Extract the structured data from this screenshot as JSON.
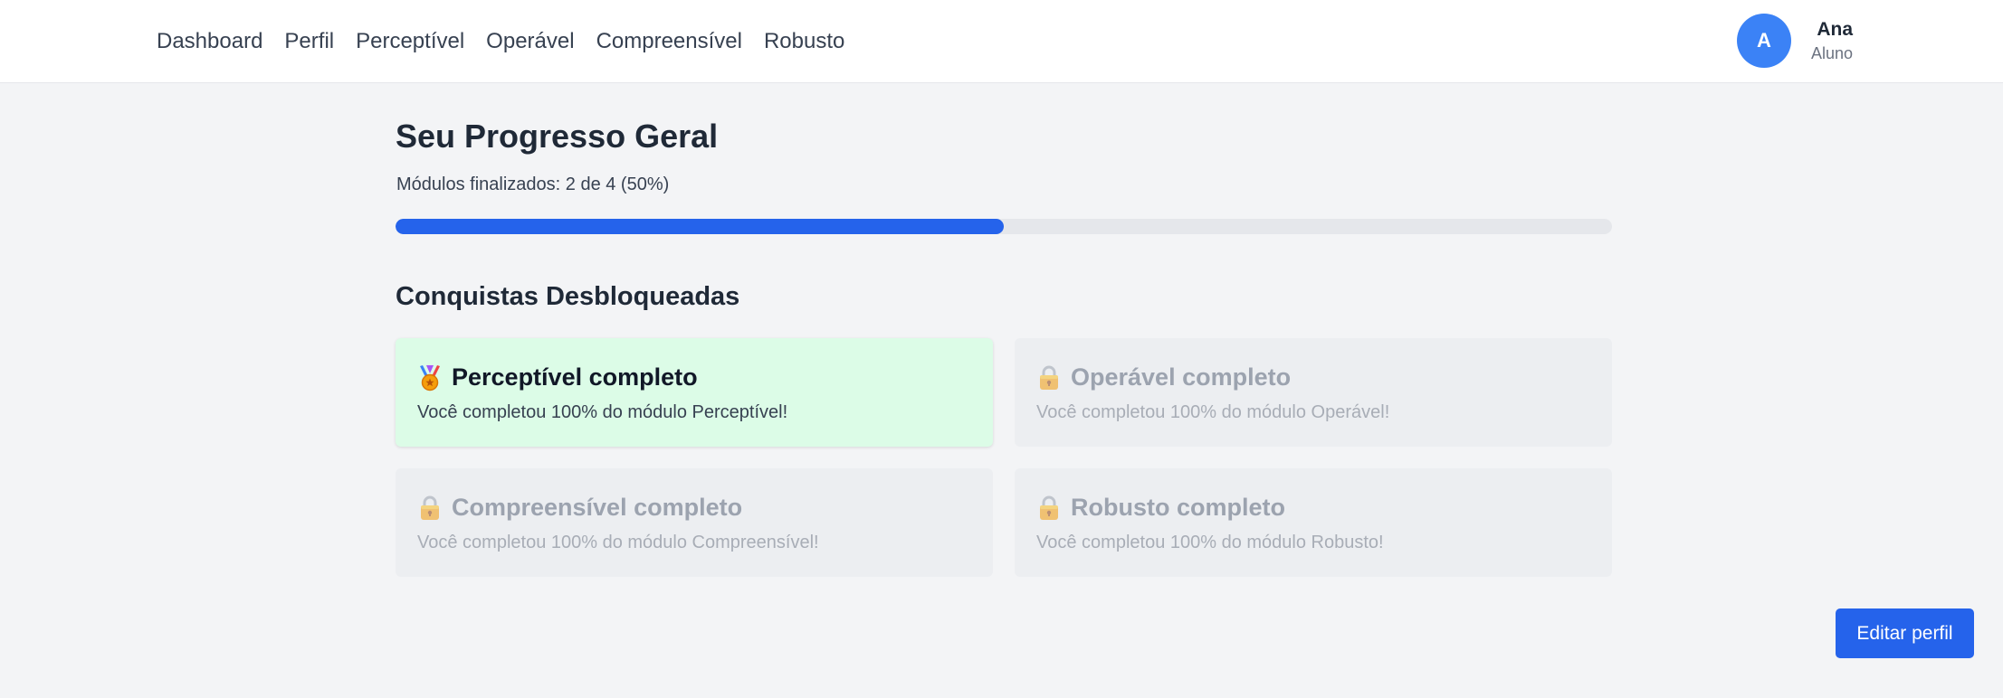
{
  "nav": {
    "items": [
      {
        "label": "Dashboard"
      },
      {
        "label": "Perfil"
      },
      {
        "label": "Perceptível"
      },
      {
        "label": "Operável"
      },
      {
        "label": "Compreensível"
      },
      {
        "label": "Robusto"
      }
    ]
  },
  "user": {
    "initial": "A",
    "name": "Ana",
    "role": "Aluno"
  },
  "progress": {
    "title": "Seu Progresso Geral",
    "summary": "Módulos finalizados: 2 de 4 (50%)",
    "completed": 2,
    "total": 4,
    "percent": 50
  },
  "achievements": {
    "title": "Conquistas Desbloqueadas",
    "items": [
      {
        "icon": "medal-icon",
        "title": "Perceptível completo",
        "description": "Você completou 100% do módulo Perceptível!",
        "unlocked": true
      },
      {
        "icon": "lock-icon",
        "title": "Operável completo",
        "description": "Você completou 100% do módulo Operável!",
        "unlocked": false
      },
      {
        "icon": "lock-icon",
        "title": "Compreensível completo",
        "description": "Você completou 100% do módulo Compreensível!",
        "unlocked": false
      },
      {
        "icon": "lock-icon",
        "title": "Robusto completo",
        "description": "Você completou 100% do módulo Robusto!",
        "unlocked": false
      }
    ]
  },
  "actions": {
    "edit_profile": "Editar perfil"
  },
  "colors": {
    "primary": "#2563eb",
    "avatar": "#3b82f6",
    "unlocked_card": "#dcfce7",
    "locked_card": "#eceef1",
    "background": "#f3f4f6"
  }
}
